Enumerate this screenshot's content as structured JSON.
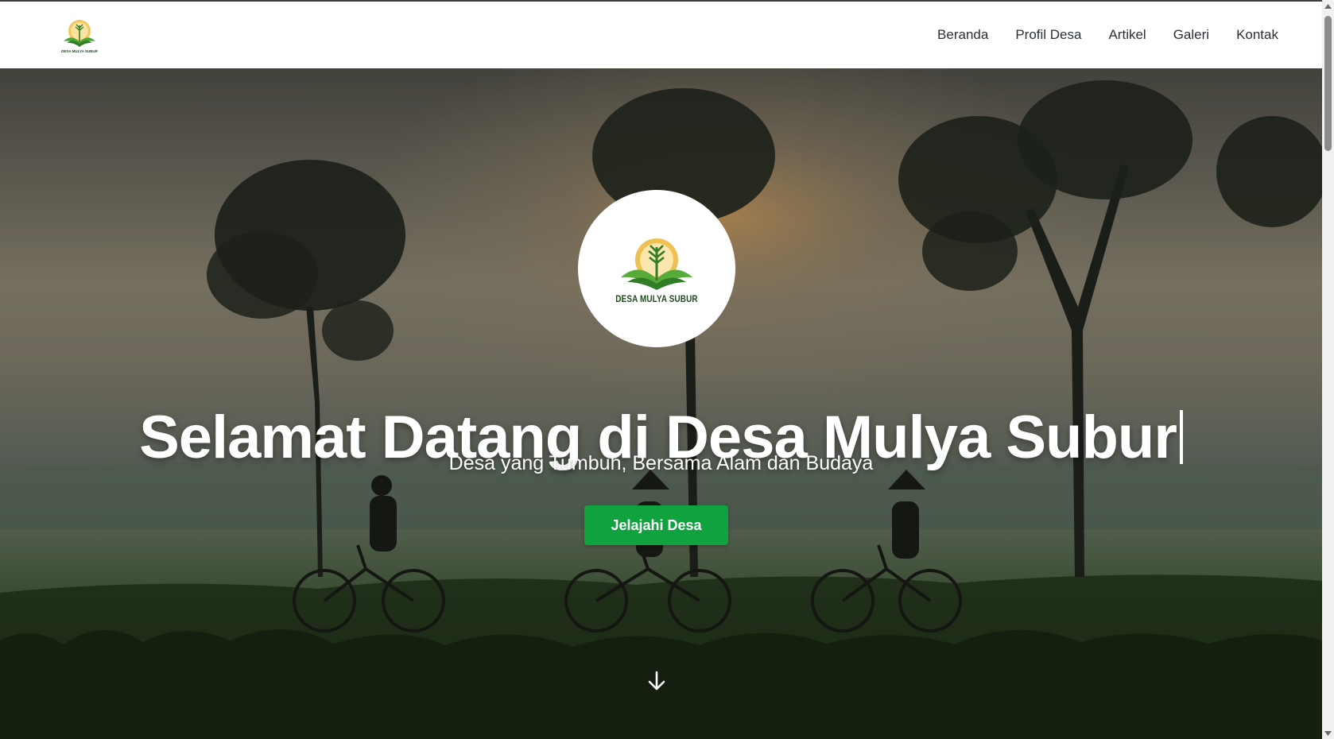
{
  "navbar": {
    "logo_icon": "desa-mulya-subur-logo",
    "logo_text": "DESA MULYA SUBUR",
    "links": [
      {
        "label": "Beranda"
      },
      {
        "label": "Profil Desa"
      },
      {
        "label": "Artikel"
      },
      {
        "label": "Galeri"
      },
      {
        "label": "Kontak"
      }
    ]
  },
  "hero": {
    "logo_text": "DESA MULYA SUBUR",
    "title": "Selamat Datang di Desa Mulya Subur",
    "subtitle": "Desa yang Tumbuh, Bersama Alam dan Budaya",
    "cta_label": "Jelajahi Desa",
    "scroll_icon": "arrow-down-icon"
  },
  "colors": {
    "accent_green": "#0fa23e",
    "nav_text": "#2b2f36",
    "logo_gold": "#e8b53a",
    "logo_leaf_green": "#3e9a2e"
  }
}
